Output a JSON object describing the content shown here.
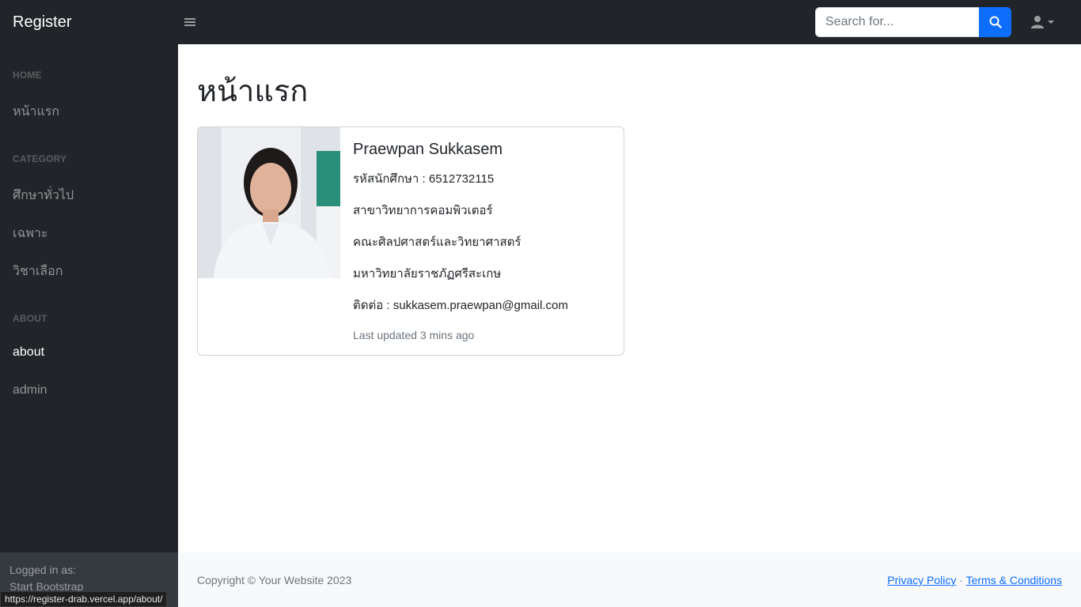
{
  "navbar": {
    "brand": "Register",
    "search_placeholder": "Search for...",
    "search_value": ""
  },
  "sidebar": {
    "headings": [
      "HOME",
      "CATEGORY",
      "ABOUT"
    ],
    "items": [
      {
        "label": "หน้าแรก"
      },
      {
        "label": "ศึกษาทั่วไป"
      },
      {
        "label": "เฉพาะ"
      },
      {
        "label": "วิชาเลือก"
      },
      {
        "label": "about"
      },
      {
        "label": "admin"
      }
    ],
    "footer": {
      "logged_in_label": "Logged in as:",
      "user": "Start Bootstrap"
    }
  },
  "main": {
    "title": "หน้าแรก",
    "card": {
      "name": "Praewpan Sukkasem",
      "student_id": "รหัสนักศึกษา : 6512732115",
      "major": "สาขาวิทยาการคอมพิวเตอร์",
      "faculty": "คณะศิลปศาสตร์และวิทยาศาสตร์",
      "university": "มหาวิทยาลัยราชภัฏศรีสะเกษ",
      "contact": "ติดต่อ : sukkasem.praewpan@gmail.com",
      "updated": "Last updated 3 mins ago"
    }
  },
  "footer": {
    "copyright": "Copyright © Your Website 2023",
    "privacy": "Privacy Policy",
    "separator": "·",
    "terms": "Terms & Conditions"
  },
  "statusbar": {
    "url": "https://register-drab.vercel.app/about/"
  },
  "colors": {
    "dark": "#212529",
    "primary": "#0d6efd",
    "light": "#f8f9fa"
  }
}
